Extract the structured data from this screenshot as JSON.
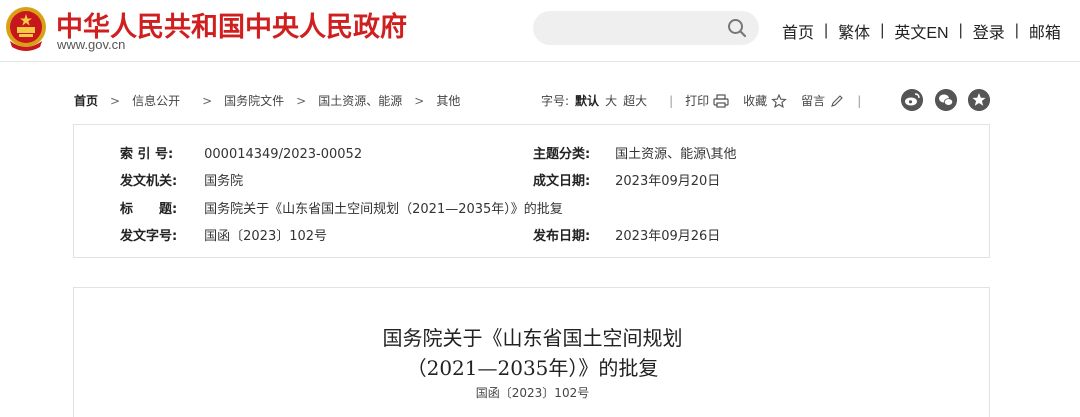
{
  "header": {
    "site_title": "中华人民共和国中央人民政府",
    "site_url": "www.gov.cn",
    "search_placeholder": "",
    "nav": [
      "首页",
      "繁体",
      "英文EN",
      "登录",
      "邮箱"
    ],
    "nav_separator": "|"
  },
  "breadcrumb": {
    "items": [
      "首页",
      "信息公开",
      "国务院文件",
      "国土资源、能源",
      "其他"
    ],
    "arrow": ">"
  },
  "tools": {
    "font_size_label": "字号:",
    "font_default": "默认",
    "font_large": "大",
    "font_xlarge": "超大",
    "print_label": "打印",
    "favorite_label": "收藏",
    "comment_label": "留言",
    "separator": "|"
  },
  "info": {
    "index_label": "索 引 号:",
    "index_value": "000014349/2023-00052",
    "category_label": "主题分类:",
    "category_value": "国土资源、能源\\其他",
    "issuer_label": "发文机关:",
    "issuer_value": "国务院",
    "written_date_label": "成文日期:",
    "written_date_value": "2023年09月20日",
    "title_label": "标　　题:",
    "title_value": "国务院关于《山东省国土空间规划（2021—2035年）》的批复",
    "doc_number_label": "发文字号:",
    "doc_number_value": "国函〔2023〕102号",
    "publish_date_label": "发布日期:",
    "publish_date_value": "2023年09月26日"
  },
  "document": {
    "title_line1": "国务院关于《山东省国土空间规划",
    "title_line2": "（2021—2035年）》的批复",
    "doc_number": "国函〔2023〕102号"
  },
  "icons": {
    "emblem": "national-emblem-icon",
    "search": "search-icon",
    "print": "printer-icon",
    "favorite": "star-icon",
    "comment": "pencil-icon",
    "weibo": "weibo-icon",
    "wechat": "wechat-icon",
    "qzone": "qzone-star-icon"
  },
  "colors": {
    "brand_red": "#d01f1f",
    "share_gray": "#555555"
  }
}
